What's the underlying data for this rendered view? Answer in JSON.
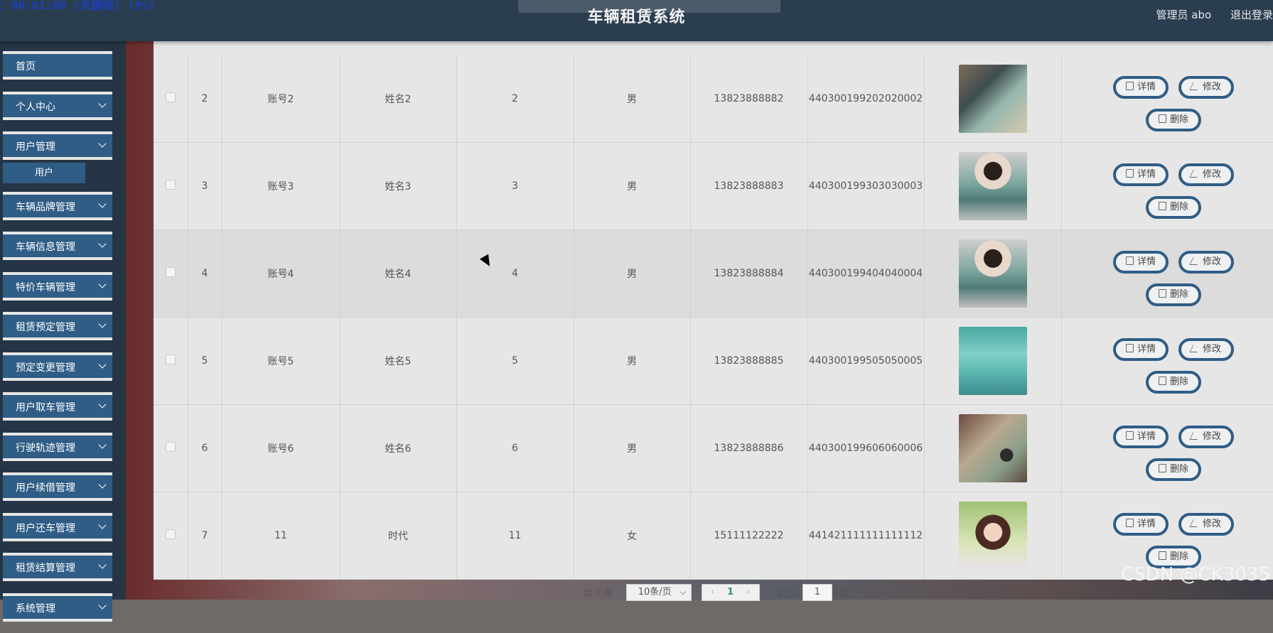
{
  "header": {
    "rec_status": "：00:01:00 (关键帧) (9%)",
    "title": "车辆租赁系统",
    "admin": "管理员 abo",
    "logout": "退出登录"
  },
  "sidebar": {
    "items": [
      {
        "label": "首页",
        "chevron": false
      },
      {
        "label": "个人中心",
        "chevron": true
      },
      {
        "label": "用户管理",
        "chevron": true,
        "sub": "用户"
      },
      {
        "label": "车辆品牌管理",
        "chevron": true
      },
      {
        "label": "车辆信息管理",
        "chevron": true
      },
      {
        "label": "特价车辆管理",
        "chevron": true
      },
      {
        "label": "租赁预定管理",
        "chevron": true
      },
      {
        "label": "预定变更管理",
        "chevron": true
      },
      {
        "label": "用户取车管理",
        "chevron": true
      },
      {
        "label": "行驶轨迹管理",
        "chevron": true
      },
      {
        "label": "用户续借管理",
        "chevron": true
      },
      {
        "label": "用户还车管理",
        "chevron": true
      },
      {
        "label": "租赁结算管理",
        "chevron": true
      },
      {
        "label": "系统管理",
        "chevron": true
      }
    ]
  },
  "table": {
    "rows": [
      {
        "index": "2",
        "account": "账号2",
        "name": "姓名2",
        "age": "2",
        "gender": "男",
        "phone": "13823888882",
        "id_number": "440300199202020002",
        "photo": "license-a"
      },
      {
        "index": "3",
        "account": "账号3",
        "name": "姓名3",
        "age": "3",
        "gender": "男",
        "phone": "13823888883",
        "id_number": "440300199303030003",
        "photo": "girl-holding-license"
      },
      {
        "index": "4",
        "account": "账号4",
        "name": "姓名4",
        "age": "4",
        "gender": "男",
        "phone": "13823888884",
        "id_number": "440300199404040004",
        "photo": "girl-holding-license"
      },
      {
        "index": "5",
        "account": "账号5",
        "name": "姓名5",
        "age": "5",
        "gender": "男",
        "phone": "13823888885",
        "id_number": "440300199505050005",
        "photo": "license-teal"
      },
      {
        "index": "6",
        "account": "账号6",
        "name": "姓名6",
        "age": "6",
        "gender": "男",
        "phone": "13823888886",
        "id_number": "440300199606060006",
        "photo": "license-held"
      },
      {
        "index": "7",
        "account": "11",
        "name": "时代",
        "age": "11",
        "gender": "女",
        "phone": "15111122222",
        "id_number": "441421111111111112",
        "photo": "girl-portrait"
      }
    ],
    "actions": {
      "detail": "详情",
      "edit": "修改",
      "delete": "删除"
    }
  },
  "pagination": {
    "total": "共 7 条",
    "page_size": "10条/页",
    "prev": "‹",
    "current": "1",
    "next": "›",
    "goto_label": "前往",
    "goto_value": "1",
    "page_unit": "页"
  },
  "watermark": "CSDN @CK3035"
}
